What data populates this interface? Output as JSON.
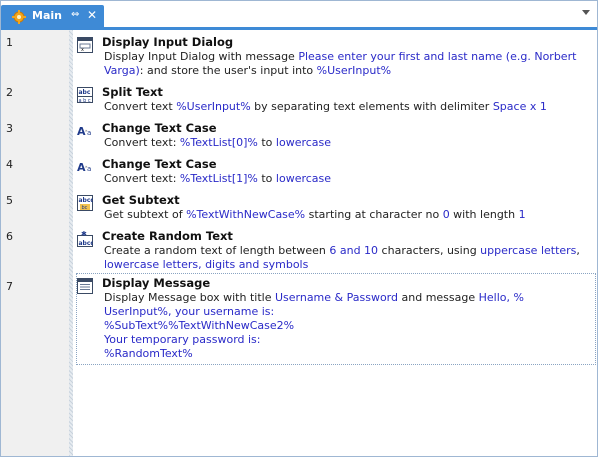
{
  "tab": {
    "label": "Main",
    "pin_glyph": "⇔",
    "close_glyph": "✕",
    "icon": "gear-icon",
    "accent_color": "#3e8ad6"
  },
  "actions": [
    {
      "line": "1",
      "icon": "input-dialog-icon",
      "title": "Display Input Dialog",
      "desc": {
        "p1": "Display Input Dialog with message ",
        "v1": "Please enter your first and last name (e.g. Norbert",
        "v1b": "Varga)",
        "p2": ": and store the user's input into ",
        "v2": "%UserInput%"
      }
    },
    {
      "line": "2",
      "icon": "split-text-icon",
      "title": "Split Text",
      "desc": {
        "p1": "Convert text ",
        "v1": "%UserInput%",
        "p2": " by separating text elements with delimiter ",
        "v2": "Space x 1"
      }
    },
    {
      "line": "3",
      "icon": "change-case-icon",
      "title": "Change Text Case",
      "desc": {
        "p1": "Convert text: ",
        "v1": "%TextList[0]%",
        "p2": " to ",
        "v2": "lowercase"
      }
    },
    {
      "line": "4",
      "icon": "change-case-icon",
      "title": "Change Text Case",
      "desc": {
        "p1": "Convert text: ",
        "v1": "%TextList[1]%",
        "p2": " to ",
        "v2": "lowercase"
      }
    },
    {
      "line": "5",
      "icon": "get-subtext-icon",
      "title": "Get Subtext",
      "desc": {
        "p1": "Get subtext of ",
        "v1": "%TextWithNewCase%",
        "p2": " starting at character no ",
        "v2": "0",
        "p3": " with length ",
        "v3": "1"
      }
    },
    {
      "line": "6",
      "icon": "random-text-icon",
      "title": "Create Random Text",
      "desc": {
        "p1": "Create a random text of length between ",
        "v1": "6 and 10",
        "p2": " characters, using ",
        "v2": "uppercase letters",
        "p3": ",",
        "v3": "lowercase letters, digits and symbols"
      }
    },
    {
      "line": "7",
      "icon": "message-box-icon",
      "title": "Display Message",
      "desc": {
        "p1": "Display Message box with title ",
        "v1": "Username & Password",
        "p2": " and message ",
        "v2": "Hello, %",
        "v3": "UserInput%, your username is:",
        "v4": "%SubText%%TextWithNewCase2%",
        "v5": "Your temporary password is:",
        "v6": "%RandomText%"
      }
    }
  ]
}
